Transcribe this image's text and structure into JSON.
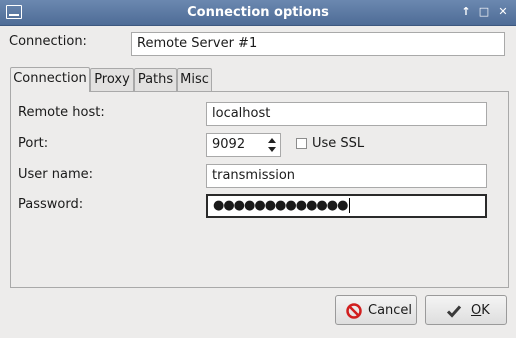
{
  "window": {
    "title": "Connection options",
    "controls": [
      "↑",
      "□",
      "✕"
    ]
  },
  "connection": {
    "label": "Connection:",
    "value": "Remote Server #1"
  },
  "tabs": [
    {
      "label": "Connection",
      "active": true
    },
    {
      "label": "Proxy",
      "active": false
    },
    {
      "label": "Paths",
      "active": false
    },
    {
      "label": "Misc",
      "active": false
    }
  ],
  "form": {
    "remote_host_label": "Remote host:",
    "remote_host_value": "localhost",
    "port_label": "Port:",
    "port_value": "9092",
    "use_ssl_label": "Use SSL",
    "use_ssl_checked": false,
    "user_name_label": "User name:",
    "user_name_value": "transmission",
    "password_label": "Password:",
    "password_value": "●●●●●●●●●●●●●"
  },
  "buttons": {
    "cancel": "Cancel",
    "ok_mnemonic": "O",
    "ok_rest": "K"
  },
  "icons": {
    "window": "window-icon",
    "cancel": "cancel-icon",
    "ok": "checkmark-icon"
  },
  "colors": {
    "titlebar": "#5a78a3",
    "cancel_icon": "#d11f1f",
    "window_bg": "#edeceb"
  }
}
